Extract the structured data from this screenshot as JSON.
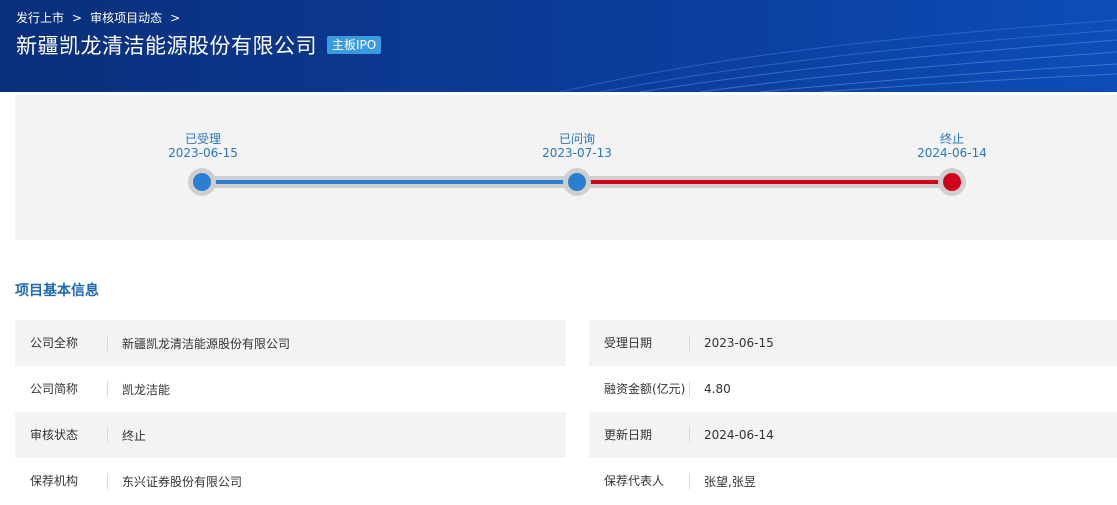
{
  "breadcrumb": {
    "level1": "发行上市",
    "level2": "审核项目动态"
  },
  "header": {
    "company_name": "新疆凯龙清洁能源股份有限公司",
    "board_tag": "主板IPO"
  },
  "timeline": {
    "stages": [
      {
        "name": "已受理",
        "date": "2023-06-15",
        "color": "#2a7fd0"
      },
      {
        "name": "已问询",
        "date": "2023-07-13",
        "color": "#2a7fd0"
      },
      {
        "name": "终止",
        "date": "2024-06-14",
        "color": "#d0021b"
      }
    ]
  },
  "section_title": "项目基本信息",
  "info": {
    "left": [
      {
        "label": "公司全称",
        "value": "新疆凯龙清洁能源股份有限公司"
      },
      {
        "label": "公司简称",
        "value": "凯龙洁能"
      },
      {
        "label": "审核状态",
        "value": "终止"
      },
      {
        "label": "保荐机构",
        "value": "东兴证券股份有限公司"
      }
    ],
    "right": [
      {
        "label": "受理日期",
        "value": "2023-06-15"
      },
      {
        "label": "融资金额(亿元)",
        "value": "4.80"
      },
      {
        "label": "更新日期",
        "value": "2024-06-14"
      },
      {
        "label": "保荐代表人",
        "value": "张望,张昱"
      }
    ]
  },
  "colors": {
    "banner": "#0b3a95",
    "accent_blue": "#2a7fd0",
    "terminated_red": "#d0021b",
    "title_blue": "#1f68b3"
  }
}
